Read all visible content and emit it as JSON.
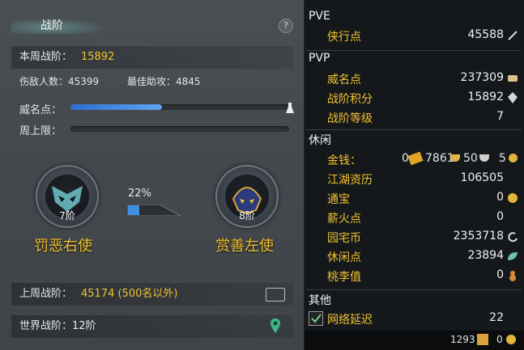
{
  "left": {
    "title": "战阶",
    "help": "?",
    "weekly_label": "本周战阶：",
    "weekly_value": "15892",
    "kills_label": "伤敌人数：45399",
    "assist_label": "最佳助攻：4845",
    "prestige_label": "威名点：",
    "prestige_fill": 0.42,
    "weekly_limit_label": "周上限：",
    "progress_percent": "22%",
    "progress_fill": 0.22,
    "medal_left": {
      "level": "7阶",
      "name": "罚恶右使"
    },
    "medal_right": {
      "level": "8阶",
      "name": "赏善左使"
    },
    "last_week_label": "上周战阶：",
    "last_week_value": "45174 (500名以外)",
    "world_label": "世界战阶：12阶"
  },
  "right": {
    "pve_title": "PVE",
    "pvp_title": "PVP",
    "leisure_title": "休闲",
    "other_title": "其他",
    "pve_items": [
      {
        "label": "侠行点",
        "value": "45588",
        "icon": "sword-icon"
      }
    ],
    "pvp_items": [
      {
        "label": "威名点",
        "value": "237309",
        "icon": "scroll-icon"
      },
      {
        "label": "战阶积分",
        "value": "15892",
        "icon": "gem-icon"
      },
      {
        "label": "战阶等级",
        "value": "7",
        "icon": ""
      }
    ],
    "money_label": "金钱：",
    "money": {
      "gold_ingot": "0",
      "silver": "7861",
      "copper": "50",
      "coin": "5"
    },
    "leisure_items": [
      {
        "label": "江湖资历",
        "value": "106505",
        "icon": ""
      },
      {
        "label": "通宝",
        "value": "0",
        "icon": "coin-icon"
      },
      {
        "label": "薪火点",
        "value": "0",
        "icon": ""
      },
      {
        "label": "园宅币",
        "value": "2353718",
        "icon": "swirl-icon"
      },
      {
        "label": "休闲点",
        "value": "23894",
        "icon": "leaf-icon"
      },
      {
        "label": "桃李值",
        "value": "0",
        "icon": "gourd-icon"
      }
    ],
    "other_items": [
      {
        "label": "网络延迟",
        "value": "22",
        "checked": true
      }
    ],
    "footer": {
      "value": "1293",
      "coins": "0"
    }
  }
}
